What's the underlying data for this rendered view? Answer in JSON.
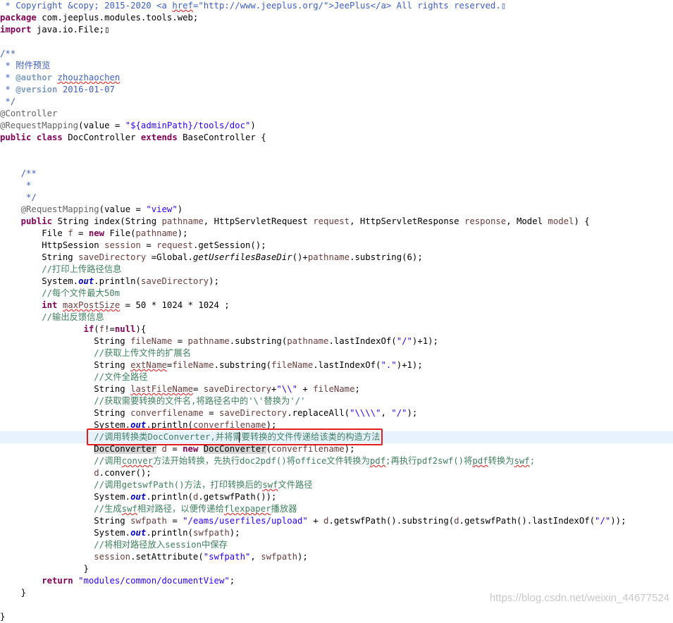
{
  "editor": {
    "language": "java",
    "current_line_index": 36,
    "lines": [
      [
        [
          "tok-jd",
          " * Copyright &copy; 2015-2020 <a "
        ],
        [
          "tok-jd sq",
          "href"
        ],
        [
          "tok-jd",
          "=\"http://www.jeeplus.org/\">JeePlus</a> All rights reserved.▯"
        ]
      ],
      [
        [
          "tok-kw",
          "package"
        ],
        [
          "tok-plain",
          " com.jeeplus.modules.tools.web;"
        ]
      ],
      [
        [
          "tok-kw",
          "import"
        ],
        [
          "tok-plain",
          " java.io.File;▯"
        ]
      ],
      [],
      [
        [
          "tok-jd",
          "/**"
        ]
      ],
      [
        [
          "tok-jd",
          " * 附件预览"
        ]
      ],
      [
        [
          "tok-jd",
          " * "
        ],
        [
          "tok-jd-tag",
          "@author"
        ],
        [
          "tok-jd-tagtext",
          " "
        ],
        [
          "tok-jd-tagtext sq",
          "zhouzhaochen"
        ]
      ],
      [
        [
          "tok-jd",
          " * "
        ],
        [
          "tok-jd-tag",
          "@version"
        ],
        [
          "tok-jd-tagtext",
          " 2016-01-07"
        ]
      ],
      [
        [
          "tok-jd",
          " */"
        ]
      ],
      [
        [
          "tok-ann",
          "@Controller"
        ]
      ],
      [
        [
          "tok-ann",
          "@RequestMapping"
        ],
        [
          "tok-plain",
          "(value = "
        ],
        [
          "tok-str",
          "\"${adminPath}/tools/doc\""
        ],
        [
          "tok-plain",
          ")"
        ]
      ],
      [
        [
          "tok-kw",
          "public class"
        ],
        [
          "tok-plain",
          " DocController "
        ],
        [
          "tok-kw",
          "extends"
        ],
        [
          "tok-plain",
          " BaseController {"
        ]
      ],
      [],
      [],
      [
        [
          "tok-jd",
          "    /**"
        ]
      ],
      [
        [
          "tok-jd",
          "     *"
        ]
      ],
      [
        [
          "tok-jd",
          "     */"
        ]
      ],
      [
        [
          "tok-ann",
          "    @RequestMapping"
        ],
        [
          "tok-plain",
          "(value = "
        ],
        [
          "tok-str",
          "\"view\""
        ],
        [
          "tok-plain",
          ")"
        ]
      ],
      [
        [
          "tok-kw",
          "    public"
        ],
        [
          "tok-plain",
          " String index(String "
        ],
        [
          "tok-var",
          "pathname"
        ],
        [
          "tok-plain",
          ", HttpServletRequest "
        ],
        [
          "tok-var",
          "request"
        ],
        [
          "tok-plain",
          ", HttpServletResponse "
        ],
        [
          "tok-var",
          "response"
        ],
        [
          "tok-plain",
          ", Model "
        ],
        [
          "tok-var",
          "model"
        ],
        [
          "tok-plain",
          ") {"
        ]
      ],
      [
        [
          "tok-plain",
          "        File "
        ],
        [
          "tok-var",
          "f"
        ],
        [
          "tok-plain",
          " = "
        ],
        [
          "tok-kw",
          "new"
        ],
        [
          "tok-plain",
          " File("
        ],
        [
          "tok-var",
          "pathname"
        ],
        [
          "tok-plain",
          ");"
        ]
      ],
      [
        [
          "tok-plain",
          "        HttpSession "
        ],
        [
          "tok-var",
          "session"
        ],
        [
          "tok-plain",
          " = "
        ],
        [
          "tok-var",
          "request"
        ],
        [
          "tok-plain",
          ".getSession();"
        ]
      ],
      [
        [
          "tok-plain",
          "        String "
        ],
        [
          "tok-var",
          "saveDirectory"
        ],
        [
          "tok-plain",
          " =Global."
        ],
        [
          "tok-smethod",
          "getUserfilesBaseDir"
        ],
        [
          "tok-plain",
          "()+"
        ],
        [
          "tok-var",
          "pathname"
        ],
        [
          "tok-plain",
          ".substring(6);"
        ]
      ],
      [
        [
          "tok-comment",
          "        //打印上传路径信息"
        ]
      ],
      [
        [
          "tok-plain",
          "        System."
        ],
        [
          "tok-static",
          "out"
        ],
        [
          "tok-plain",
          ".println("
        ],
        [
          "tok-var",
          "saveDirectory"
        ],
        [
          "tok-plain",
          ");"
        ]
      ],
      [
        [
          "tok-comment",
          "        //每个文件最大50m"
        ]
      ],
      [
        [
          "tok-kw",
          "        int"
        ],
        [
          "tok-plain",
          " "
        ],
        [
          "tok-var sq",
          "maxPostSize"
        ],
        [
          "tok-plain",
          " = 50 * 1024 * 1024 ;"
        ]
      ],
      [
        [
          "tok-comment",
          "        //输出反馈信息"
        ]
      ],
      [
        [
          "tok-kw",
          "                if"
        ],
        [
          "tok-plain",
          "("
        ],
        [
          "tok-var",
          "f"
        ],
        [
          "tok-plain",
          "!="
        ],
        [
          "tok-kw",
          "null"
        ],
        [
          "tok-plain",
          "){"
        ]
      ],
      [
        [
          "tok-plain",
          "                  String "
        ],
        [
          "tok-var",
          "fileName"
        ],
        [
          "tok-plain",
          " = "
        ],
        [
          "tok-var",
          "pathname"
        ],
        [
          "tok-plain",
          ".substring("
        ],
        [
          "tok-var",
          "pathname"
        ],
        [
          "tok-plain",
          ".lastIndexOf("
        ],
        [
          "tok-str",
          "\"/\""
        ],
        [
          "tok-plain",
          ")+1);"
        ]
      ],
      [
        [
          "tok-comment",
          "                  //获取上传文件的扩展名"
        ]
      ],
      [
        [
          "tok-plain",
          "                  String "
        ],
        [
          "tok-var sq",
          "extName"
        ],
        [
          "tok-plain",
          "="
        ],
        [
          "tok-var",
          "fileName"
        ],
        [
          "tok-plain",
          ".substring("
        ],
        [
          "tok-var",
          "fileName"
        ],
        [
          "tok-plain",
          ".lastIndexOf("
        ],
        [
          "tok-str",
          "\".\""
        ],
        [
          "tok-plain",
          ")+1);"
        ]
      ],
      [
        [
          "tok-comment",
          "                  //文件全路径"
        ]
      ],
      [
        [
          "tok-plain",
          "                  String "
        ],
        [
          "tok-var sq",
          "lastFileName"
        ],
        [
          "tok-plain",
          "= "
        ],
        [
          "tok-var",
          "saveDirectory"
        ],
        [
          "tok-plain",
          "+"
        ],
        [
          "tok-str",
          "\"\\\\\""
        ],
        [
          "tok-plain",
          " + "
        ],
        [
          "tok-var",
          "fileName"
        ],
        [
          "tok-plain",
          ";"
        ]
      ],
      [
        [
          "tok-comment",
          "                  //获取需要转换的文件名,将路径名中的'\\'替换为'/'"
        ]
      ],
      [
        [
          "tok-plain",
          "                  String "
        ],
        [
          "tok-var",
          "converfilename"
        ],
        [
          "tok-plain",
          " = "
        ],
        [
          "tok-var",
          "saveDirectory"
        ],
        [
          "tok-plain",
          ".replaceAll("
        ],
        [
          "tok-str",
          "\"\\\\\\\\\""
        ],
        [
          "tok-plain",
          ", "
        ],
        [
          "tok-str",
          "\"/\""
        ],
        [
          "tok-plain",
          ");"
        ]
      ],
      [
        [
          "tok-plain",
          "                  System."
        ],
        [
          "tok-static",
          "out"
        ],
        [
          "tok-plain",
          ".println("
        ],
        [
          "tok-var",
          "converfilename"
        ],
        [
          "tok-plain",
          ");"
        ]
      ],
      [
        [
          "tok-comment",
          "                  //调用转换类DocConverter,并将需要转换的文件传递给该类的构造方法"
        ]
      ],
      [
        [
          "tok-plain",
          "                  "
        ],
        [
          "tok-plain tok-sel",
          "DocConverter"
        ],
        [
          "tok-plain",
          " "
        ],
        [
          "tok-var",
          "d"
        ],
        [
          "tok-plain",
          " = "
        ],
        [
          "tok-kw",
          "new"
        ],
        [
          "tok-plain",
          " "
        ],
        [
          "tok-plain tok-sel",
          "DocConverter"
        ],
        [
          "tok-plain",
          "("
        ],
        [
          "tok-var",
          "converfilename"
        ],
        [
          "tok-plain",
          ");"
        ]
      ],
      [
        [
          "tok-comment",
          "                  //调用"
        ],
        [
          "tok-comment sq",
          "conver"
        ],
        [
          "tok-comment",
          "方法开始转换，先执行doc2pdf()将office文件转换为"
        ],
        [
          "tok-comment sq",
          "pdf"
        ],
        [
          "tok-comment",
          ";再执行pdf2swf()将"
        ],
        [
          "tok-comment sq",
          "pdf"
        ],
        [
          "tok-comment",
          "转换为"
        ],
        [
          "tok-comment sq",
          "swf"
        ],
        [
          "tok-comment",
          ";"
        ]
      ],
      [
        [
          "tok-var",
          "                  d"
        ],
        [
          "tok-plain",
          ".conver();"
        ]
      ],
      [
        [
          "tok-comment",
          "                  //调用getswfPath()方法，打印转换后的"
        ],
        [
          "tok-comment sq",
          "swf"
        ],
        [
          "tok-comment",
          "文件路径"
        ]
      ],
      [
        [
          "tok-plain",
          "                  System."
        ],
        [
          "tok-static",
          "out"
        ],
        [
          "tok-plain",
          ".println("
        ],
        [
          "tok-var",
          "d"
        ],
        [
          "tok-plain",
          ".getswfPath());"
        ]
      ],
      [
        [
          "tok-comment",
          "                  //生成"
        ],
        [
          "tok-comment sq",
          "swf"
        ],
        [
          "tok-comment",
          "相对路径，以便传递给"
        ],
        [
          "tok-comment sq",
          "flexpaper"
        ],
        [
          "tok-comment",
          "播放器"
        ]
      ],
      [
        [
          "tok-plain",
          "                  String "
        ],
        [
          "tok-var",
          "swfpath"
        ],
        [
          "tok-plain",
          " = "
        ],
        [
          "tok-str",
          "\"/eams/userfiles/upload\""
        ],
        [
          "tok-plain",
          " + "
        ],
        [
          "tok-var",
          "d"
        ],
        [
          "tok-plain",
          ".getswfPath().substring("
        ],
        [
          "tok-var",
          "d"
        ],
        [
          "tok-plain",
          ".getswfPath().lastIndexOf("
        ],
        [
          "tok-str",
          "\"/\""
        ],
        [
          "tok-plain",
          "));"
        ]
      ],
      [
        [
          "tok-plain",
          "                  System."
        ],
        [
          "tok-static",
          "out"
        ],
        [
          "tok-plain",
          ".println("
        ],
        [
          "tok-var",
          "swfpath"
        ],
        [
          "tok-plain",
          ");"
        ]
      ],
      [
        [
          "tok-comment",
          "                  //将相对路径放入session中保存"
        ]
      ],
      [
        [
          "tok-var",
          "                  session"
        ],
        [
          "tok-plain",
          ".setAttribute("
        ],
        [
          "tok-str",
          "\"swfpath\""
        ],
        [
          "tok-plain",
          ", "
        ],
        [
          "tok-var",
          "swfpath"
        ],
        [
          "tok-plain",
          ");"
        ]
      ],
      [
        [
          "tok-plain",
          "                }"
        ]
      ],
      [
        [
          "tok-kw",
          "        return"
        ],
        [
          "tok-plain",
          " "
        ],
        [
          "tok-str",
          "\"modules/common/documentView\""
        ],
        [
          "tok-plain",
          ";"
        ]
      ],
      [
        [
          "tok-plain",
          "    }"
        ]
      ],
      [],
      [
        [
          "tok-plain",
          "}"
        ]
      ]
    ]
  },
  "watermark": {
    "text": "https://blog.csdn.net/weixin_44677524"
  }
}
